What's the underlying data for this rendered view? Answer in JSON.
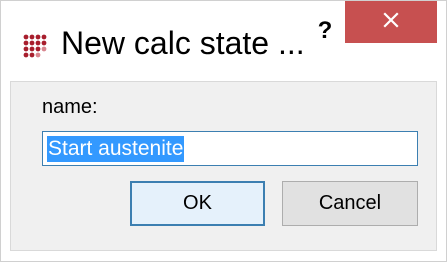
{
  "window": {
    "title": "New calc state ...",
    "help_glyph": "?",
    "close_icon": "close-icon",
    "app_icon": "dot-cluster-icon",
    "accent_color": "#c75050"
  },
  "form": {
    "name_label": "name:",
    "name_value": "Start austenite",
    "name_selected": true
  },
  "buttons": {
    "ok_label": "OK",
    "cancel_label": "Cancel"
  }
}
